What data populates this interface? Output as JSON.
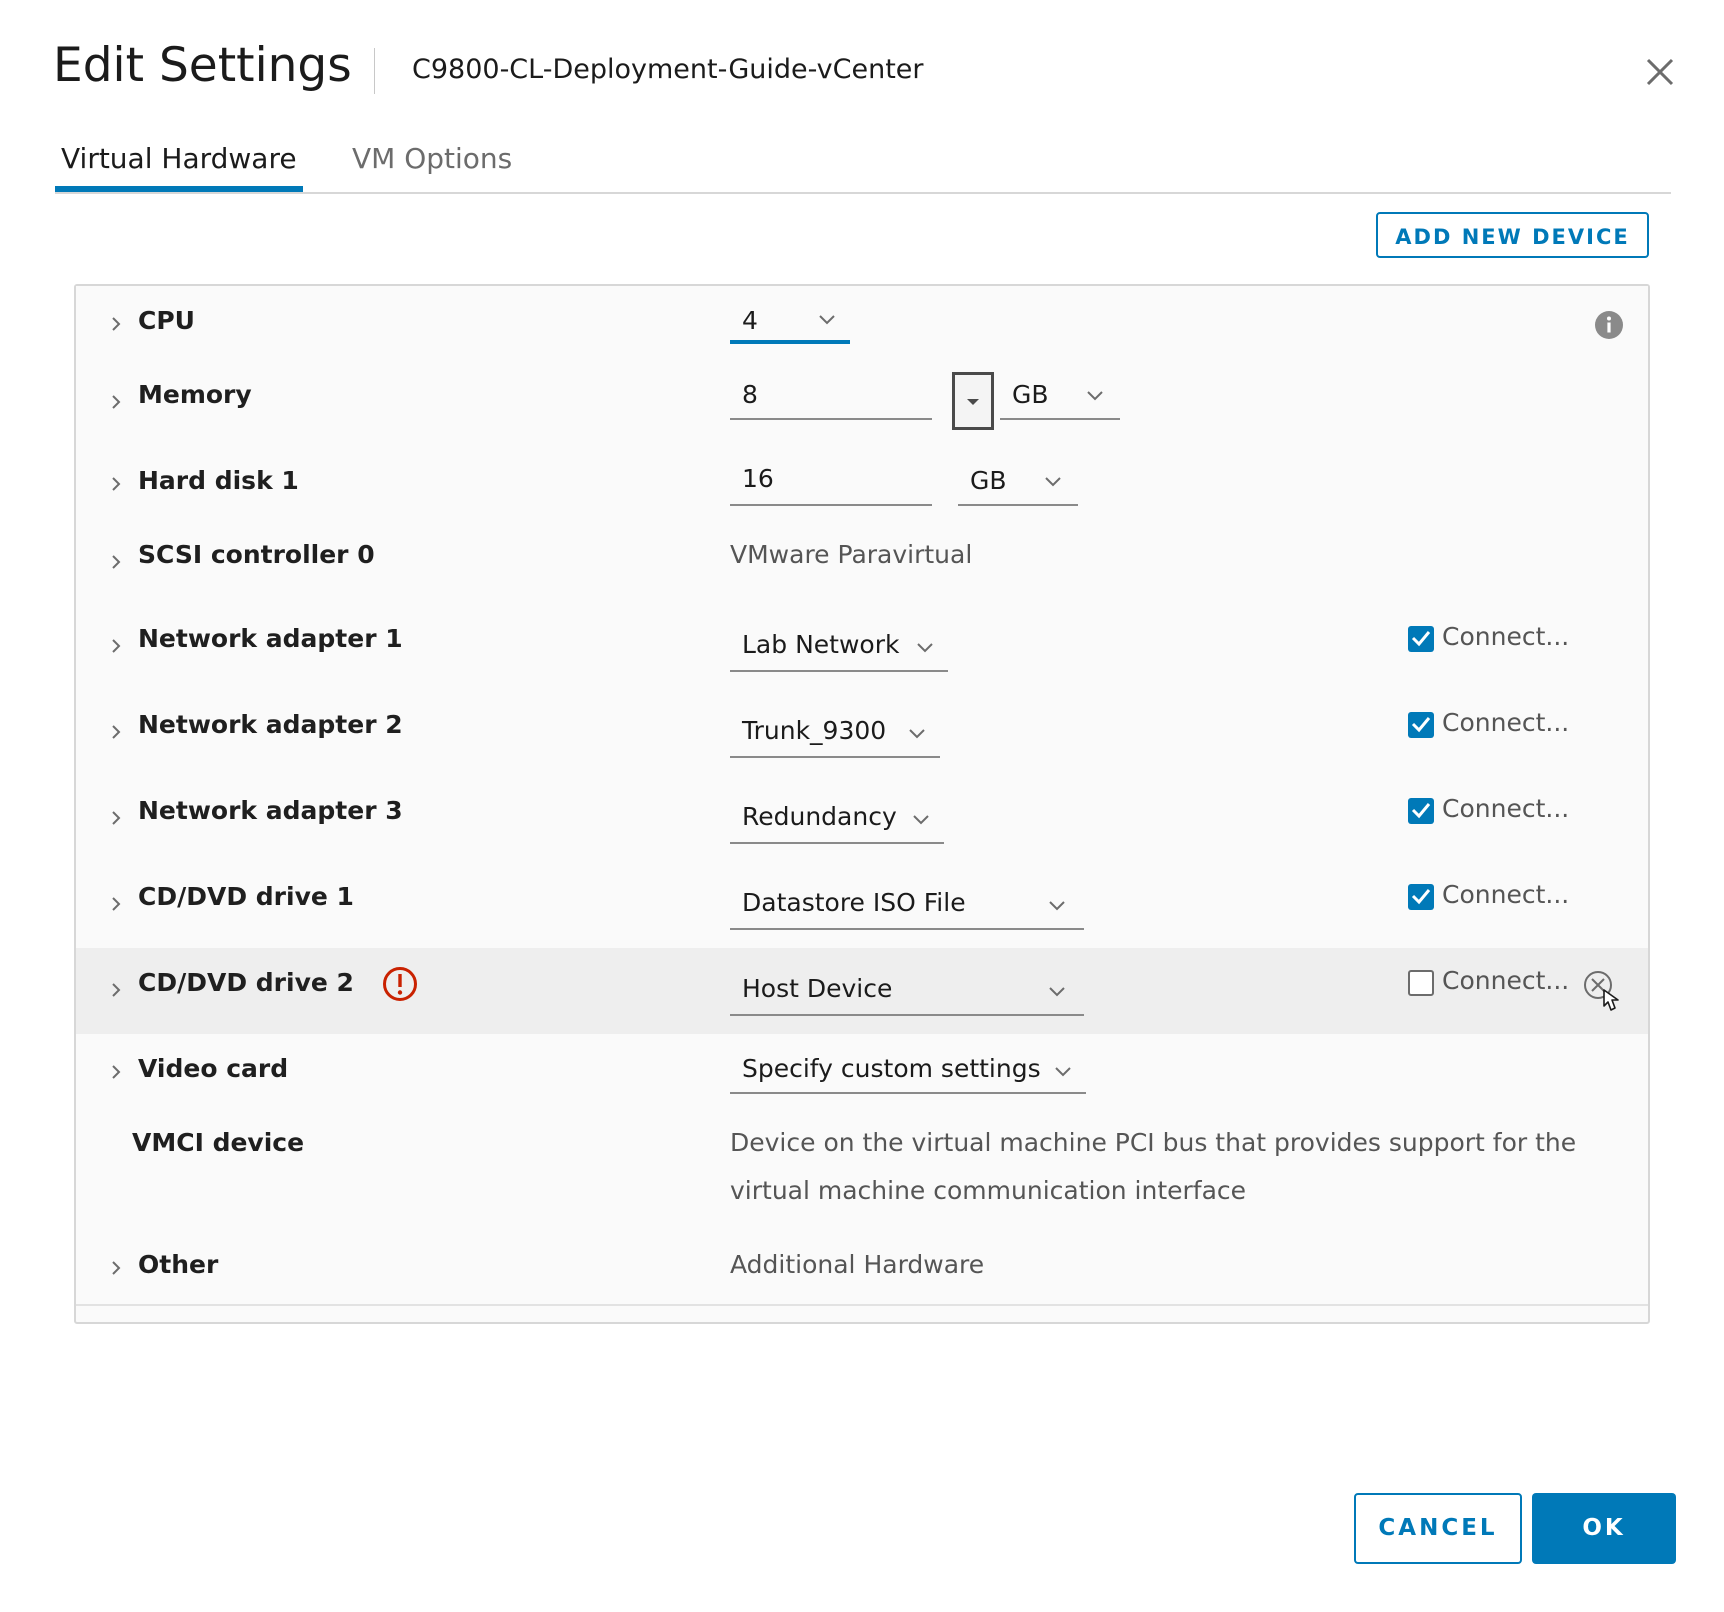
{
  "dialog": {
    "title": "Edit Settings",
    "vm_name": "C9800-CL-Deployment-Guide-vCenter",
    "close_icon": "close-icon"
  },
  "tabs": [
    {
      "label": "Virtual Hardware",
      "active": true
    },
    {
      "label": "VM Options",
      "active": false
    }
  ],
  "toolbar": {
    "add_device_label": "ADD NEW DEVICE"
  },
  "hardware": {
    "cpu": {
      "label": "CPU",
      "value": "4"
    },
    "memory": {
      "label": "Memory",
      "value": "8",
      "unit": "GB"
    },
    "hard_disk": {
      "label": "Hard disk 1",
      "value": "16",
      "unit": "GB"
    },
    "scsi": {
      "label": "SCSI controller 0",
      "value": "VMware Paravirtual"
    },
    "net1": {
      "label": "Network adapter 1",
      "value": "Lab Network",
      "connect_label": "Connect...",
      "connected": true
    },
    "net2": {
      "label": "Network adapter 2",
      "value": "Trunk_9300",
      "connect_label": "Connect...",
      "connected": true
    },
    "net3": {
      "label": "Network adapter 3",
      "value": "Redundancy",
      "connect_label": "Connect...",
      "connected": true
    },
    "cd1": {
      "label": "CD/DVD drive 1",
      "value": "Datastore ISO File",
      "connect_label": "Connect...",
      "connected": true
    },
    "cd2": {
      "label": "CD/DVD drive 2",
      "value": "Host Device",
      "connect_label": "Connect...",
      "connected": false
    },
    "video": {
      "label": "Video card",
      "value": "Specify custom settings"
    },
    "vmci": {
      "label": "VMCI device",
      "description_line1": "Device on the virtual machine PCI bus that provides support for the",
      "description_line2": "virtual machine communication interface"
    },
    "other": {
      "label": "Other",
      "value": "Additional Hardware"
    }
  },
  "footer": {
    "cancel_label": "CANCEL",
    "ok_label": "OK"
  },
  "colors": {
    "accent": "#0079b8",
    "warning": "#c92100"
  }
}
